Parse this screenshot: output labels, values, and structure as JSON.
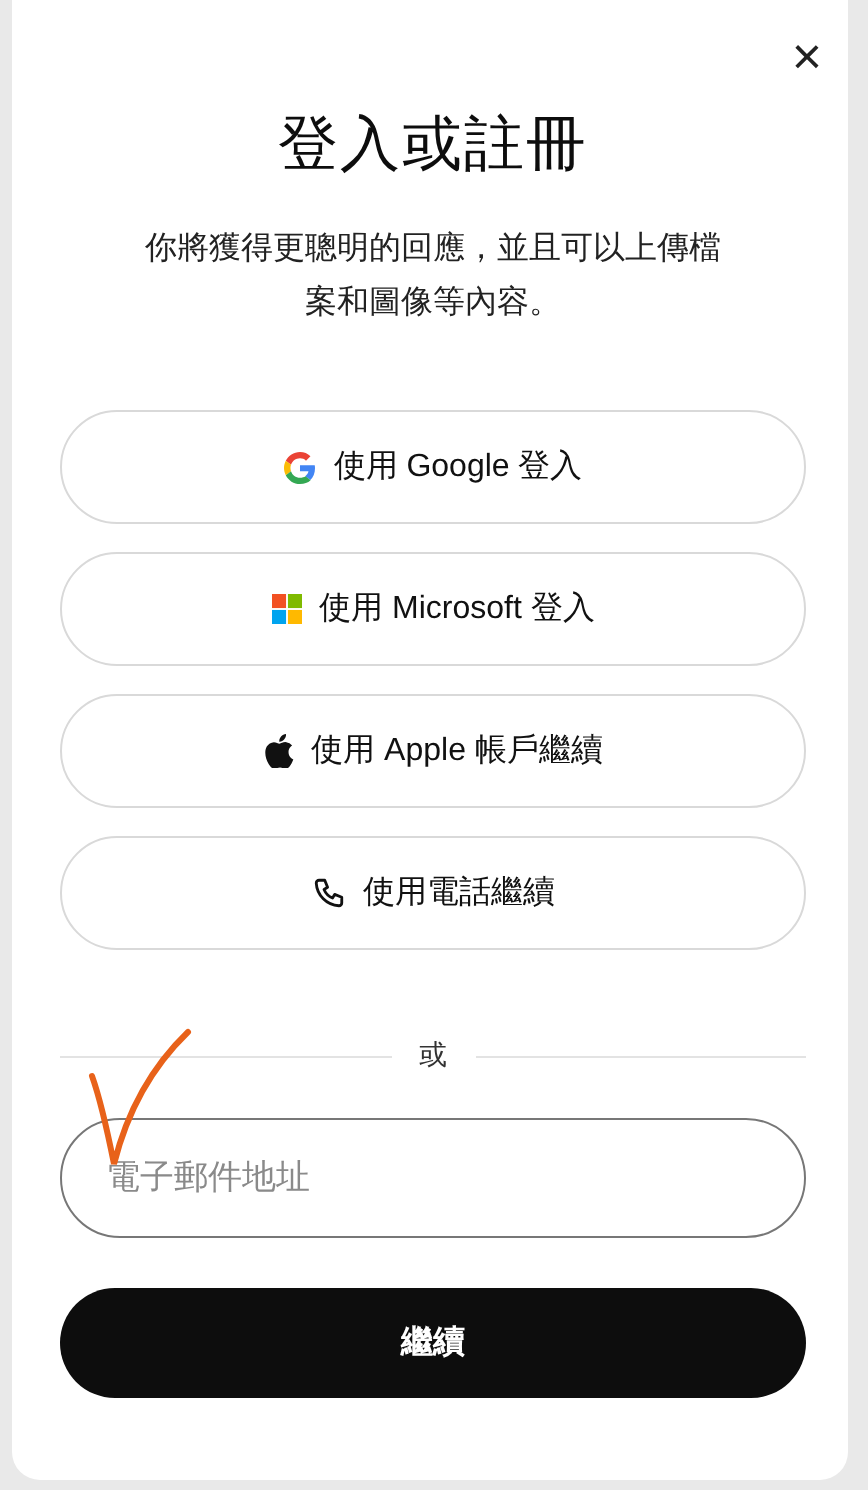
{
  "dialog": {
    "close": "×",
    "title": "登入或註冊",
    "subtitle": "你將獲得更聰明的回應，並且可以上傳檔案和圖像等內容。"
  },
  "providers": [
    {
      "kind": "google",
      "label": "使用 Google 登入"
    },
    {
      "kind": "microsoft",
      "label": "使用 Microsoft 登入"
    },
    {
      "kind": "apple",
      "label": "使用 Apple 帳戶繼續"
    },
    {
      "kind": "phone",
      "label": "使用電話繼續"
    }
  ],
  "divider": "或",
  "email": {
    "placeholder": "電子郵件地址"
  },
  "continue": "繼續",
  "annotation": {
    "kind": "checkmark",
    "color": "#e8621a"
  }
}
